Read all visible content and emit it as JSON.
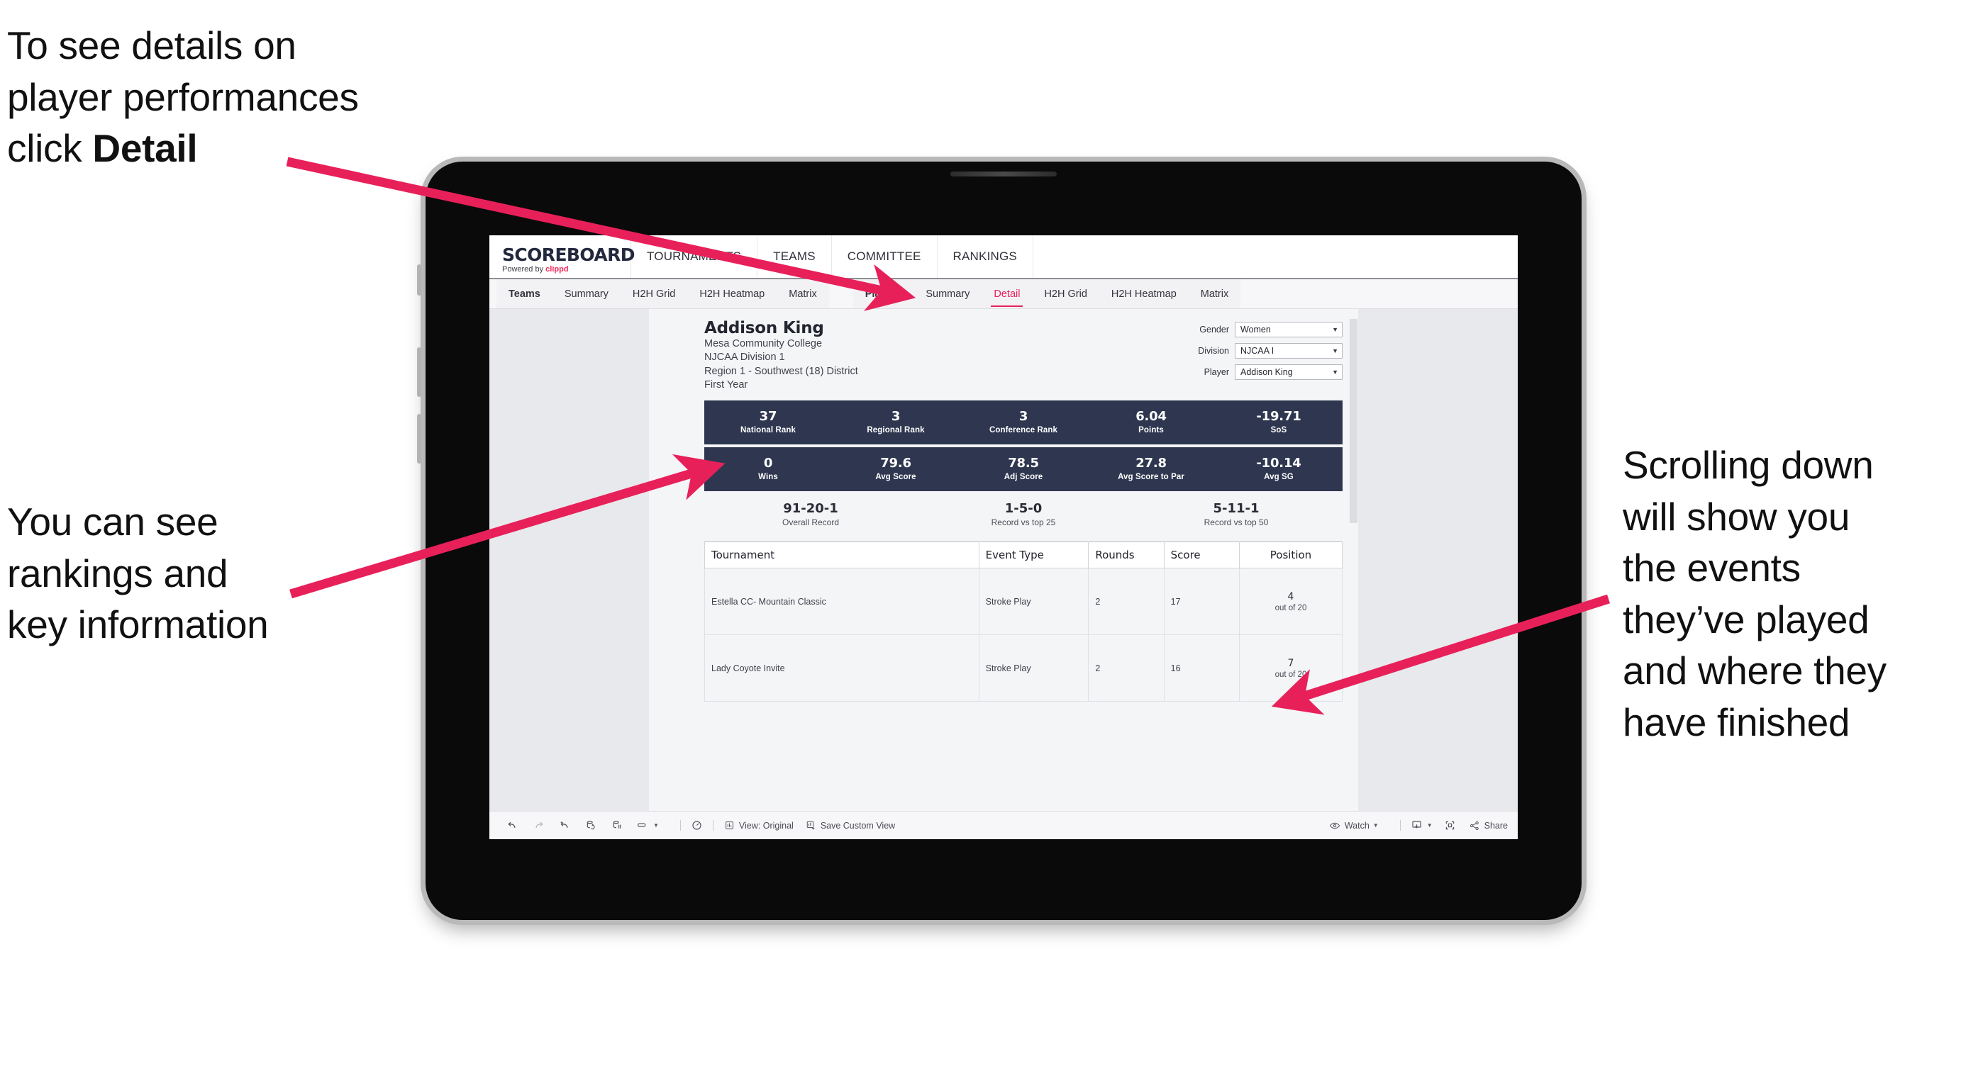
{
  "annotations": {
    "detail": {
      "line1": "To see details on",
      "line2": "player performances",
      "line3_pre": "click ",
      "line3_bold": "Detail"
    },
    "rankings": {
      "line1": "You can see",
      "line2": "rankings and",
      "line3": "key information"
    },
    "scrolling": {
      "line1": "Scrolling down",
      "line2": "will show you",
      "line3": "the events",
      "line4": "they’ve played",
      "line5": "and where they",
      "line6": "have finished"
    },
    "arrow_color": "#e8205a"
  },
  "app": {
    "logo_main": "SCOREBOARD",
    "logo_sub_prefix": "Powered by ",
    "logo_sub_brand": "clippd",
    "topnav": [
      {
        "label": "TOURNAMENTS"
      },
      {
        "label": "TEAMS"
      },
      {
        "label": "COMMITTEE"
      },
      {
        "label": "RANKINGS"
      }
    ],
    "subnav_group_teams": [
      {
        "label": "Teams",
        "active": false
      },
      {
        "label": "Summary",
        "active": false
      },
      {
        "label": "H2H Grid",
        "active": false
      },
      {
        "label": "H2H Heatmap",
        "active": false
      },
      {
        "label": "Matrix",
        "active": false
      }
    ],
    "subnav_group_players": [
      {
        "label": "Players",
        "active": false
      },
      {
        "label": "Summary",
        "active": false
      },
      {
        "label": "Detail",
        "active": true
      },
      {
        "label": "H2H Grid",
        "active": false
      },
      {
        "label": "H2H Heatmap",
        "active": false
      },
      {
        "label": "Matrix",
        "active": false
      }
    ]
  },
  "player": {
    "name": "Addison King",
    "school": "Mesa Community College",
    "division": "NJCAA Division 1",
    "region": "Region 1 - Southwest (18) District",
    "year": "First Year"
  },
  "filters": [
    {
      "label": "Gender",
      "value": "Women"
    },
    {
      "label": "Division",
      "value": "NJCAA I"
    },
    {
      "label": "Player",
      "value": "Addison King"
    }
  ],
  "stats_band_1": [
    {
      "value": "37",
      "label": "National Rank"
    },
    {
      "value": "3",
      "label": "Regional Rank"
    },
    {
      "value": "3",
      "label": "Conference Rank"
    },
    {
      "value": "6.04",
      "label": "Points"
    },
    {
      "value": "-19.71",
      "label": "SoS"
    }
  ],
  "stats_band_2": [
    {
      "value": "0",
      "label": "Wins"
    },
    {
      "value": "79.6",
      "label": "Avg Score"
    },
    {
      "value": "78.5",
      "label": "Adj Score"
    },
    {
      "value": "27.8",
      "label": "Avg Score to Par"
    },
    {
      "value": "-10.14",
      "label": "Avg SG"
    }
  ],
  "records": [
    {
      "value": "91-20-1",
      "label": "Overall Record"
    },
    {
      "value": "1-5-0",
      "label": "Record vs top 25"
    },
    {
      "value": "5-11-1",
      "label": "Record vs top 50"
    }
  ],
  "events_table": {
    "columns": [
      "Tournament",
      "Event Type",
      "Rounds",
      "Score",
      "Position"
    ],
    "rows": [
      {
        "tournament": "Estella CC- Mountain Classic",
        "event_type": "Stroke Play",
        "rounds": "2",
        "score": "17",
        "position": "4",
        "position_of": "out of 20"
      },
      {
        "tournament": "Lady Coyote Invite",
        "event_type": "Stroke Play",
        "rounds": "2",
        "score": "16",
        "position": "7",
        "position_of": "out of 20"
      }
    ]
  },
  "toolbar": {
    "view_label": "View: Original",
    "save_label": "Save Custom View",
    "watch_label": "Watch",
    "share_label": "Share"
  },
  "colors": {
    "band_navy": "#2f3750",
    "accent_pink": "#e8205a",
    "viz_bg": "#e8e9ec"
  }
}
